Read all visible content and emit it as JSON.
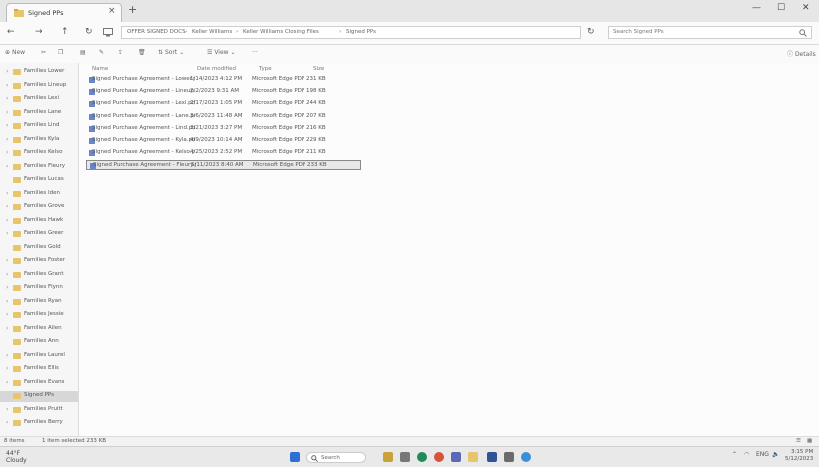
{
  "window": {
    "tab_title": "Signed PPs",
    "close": "×",
    "newtab": "+",
    "minimize": "—",
    "maximize": "☐",
    "win_close": "✕"
  },
  "address": {
    "crumbs": [
      "OFFER SIGNED DOCS",
      "Keller Williams",
      "Keller Williams Closing Files",
      "Signed PPs"
    ],
    "search_placeholder": "Search Signed PPs"
  },
  "toolbar": {
    "new": "New",
    "sort": "Sort",
    "view": "View",
    "more": "···",
    "details": "Details"
  },
  "sidebar": {
    "items": [
      {
        "label": "Families Lower",
        "chev": "›"
      },
      {
        "label": "Families Lineup",
        "chev": "›"
      },
      {
        "label": "Families Lexi",
        "chev": "›"
      },
      {
        "label": "Families Lane",
        "chev": "›"
      },
      {
        "label": "Families Lind",
        "chev": "›"
      },
      {
        "label": "Families Kyla",
        "chev": "›"
      },
      {
        "label": "Families Kelso",
        "chev": "›"
      },
      {
        "label": "Families Fleury",
        "chev": "›"
      },
      {
        "label": "Families Lucas",
        "chev": ""
      },
      {
        "label": "Families Iden",
        "chev": "›"
      },
      {
        "label": "Families Grove",
        "chev": "›"
      },
      {
        "label": "Families Hawk",
        "chev": "›"
      },
      {
        "label": "Families Greer",
        "chev": "›"
      },
      {
        "label": "Families Gold",
        "chev": ""
      },
      {
        "label": "Families Foster",
        "chev": "›"
      },
      {
        "label": "Families Grant",
        "chev": "›"
      },
      {
        "label": "Families Flynn",
        "chev": "›"
      },
      {
        "label": "Families Ryan",
        "chev": "›"
      },
      {
        "label": "Families Jessie",
        "chev": "›"
      },
      {
        "label": "Families Allen",
        "chev": "›"
      },
      {
        "label": "Families Ann",
        "chev": ""
      },
      {
        "label": "Families Laurel",
        "chev": "›"
      },
      {
        "label": "Families Ellis",
        "chev": "›"
      },
      {
        "label": "Families Evans",
        "chev": "›"
      },
      {
        "label": "Signed PPs",
        "chev": "",
        "selected": true
      },
      {
        "label": "Families Pruitt",
        "chev": "›"
      },
      {
        "label": "Families Berry",
        "chev": "›"
      }
    ]
  },
  "content": {
    "columns": {
      "name": "Name",
      "date": "Date modified",
      "type": "Type",
      "size": "Size"
    },
    "rows": [
      {
        "name": "Signed Purchase Agreement - Lower.pdf",
        "date": "1/14/2023 4:12 PM",
        "type": "Microsoft Edge PDF",
        "size": "231 KB"
      },
      {
        "name": "Signed Purchase Agreement - Lineup.pdf",
        "date": "2/2/2023 9:31 AM",
        "type": "Microsoft Edge PDF",
        "size": "198 KB"
      },
      {
        "name": "Signed Purchase Agreement - Lexi.pdf",
        "date": "2/17/2023 1:05 PM",
        "type": "Microsoft Edge PDF",
        "size": "244 KB"
      },
      {
        "name": "Signed Purchase Agreement - Lane.pdf",
        "date": "3/6/2023 11:48 AM",
        "type": "Microsoft Edge PDF",
        "size": "207 KB"
      },
      {
        "name": "Signed Purchase Agreement - Lind.pdf",
        "date": "3/21/2023 3:27 PM",
        "type": "Microsoft Edge PDF",
        "size": "216 KB"
      },
      {
        "name": "Signed Purchase Agreement - Kyla.pdf",
        "date": "4/9/2023 10:14 AM",
        "type": "Microsoft Edge PDF",
        "size": "229 KB"
      },
      {
        "name": "Signed Purchase Agreement - Kelso.pdf",
        "date": "4/25/2023 2:52 PM",
        "type": "Microsoft Edge PDF",
        "size": "211 KB"
      },
      {
        "name": "Signed Purchase Agreement - Fleury.pdf",
        "date": "5/11/2023 8:40 AM",
        "type": "Microsoft Edge PDF",
        "size": "233 KB",
        "selected": true
      }
    ]
  },
  "status": {
    "count": "8 items",
    "selected": "1 item selected  233 KB"
  },
  "taskbar": {
    "temp": "44°F",
    "weather": "Cloudy",
    "search": "Search",
    "lang": "ENG",
    "time": "3:15 PM",
    "date": "5/12/2023"
  },
  "colors": {
    "folder": "#e8c46a",
    "pdf": "#6a86c9",
    "selection": "#d7d7d7"
  }
}
